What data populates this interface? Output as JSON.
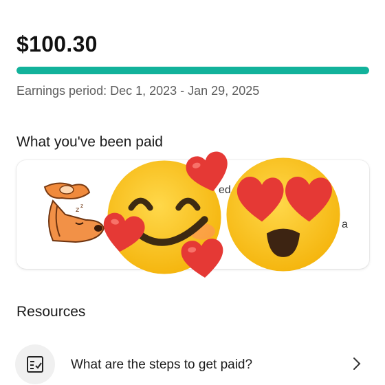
{
  "earnings": {
    "amount": "$100.30",
    "progress_fraction": 1.0,
    "period": "Earnings period: Dec 1, 2023 - Jan 29, 2025"
  },
  "paid_section": {
    "title": "What you've been paid",
    "partial_texts": [
      "ed",
      "a"
    ]
  },
  "resources": {
    "title": "Resources",
    "items": [
      {
        "label": "What are the steps to get paid?",
        "icon": "checklist-icon"
      }
    ]
  },
  "colors": {
    "accent": "#12b29b",
    "emoji_yellow": "#fcc21b",
    "heart_red": "#e53935"
  },
  "stickers": [
    "sleeping-dog-sticker",
    "smiling-face-with-hearts-emoji",
    "heart-eyes-emoji"
  ]
}
